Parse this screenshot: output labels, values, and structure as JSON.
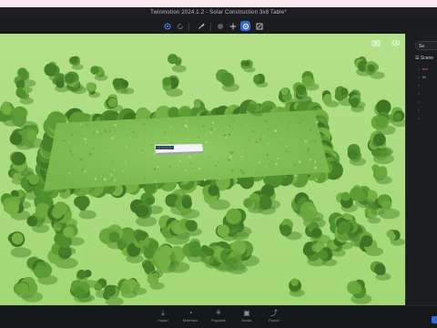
{
  "window": {
    "title": "Twinmotion 2024.1.2 - Solar Construction 3x8 Table*"
  },
  "toolbar": {
    "icons": [
      "snap-icon",
      "refresh-icon",
      "eyedropper-icon",
      "record-icon",
      "move-icon",
      "rotate-icon",
      "scale-icon"
    ],
    "active": "rotate-icon",
    "accent_color": "#2f6bd8"
  },
  "viewport": {
    "scene": "aerial view of cleared grass field surrounded by trees with a solar panel table in the center",
    "icons": [
      "camera-icon",
      "view-options-icon"
    ]
  },
  "side_panel": {
    "search_placeholder": "Se",
    "scene_label": "Scene",
    "tree_items": [
      {
        "label": "Ani",
        "color": "#d66b8a"
      },
      {
        "label": "Br",
        "color": "#aab0ba"
      },
      {
        "label": "",
        "color": "#aab0ba"
      },
      {
        "label": "",
        "color": "#aab0ba"
      },
      {
        "label": "",
        "color": "#aab0ba"
      },
      {
        "label": "",
        "color": "#aab0ba"
      },
      {
        "label": "",
        "color": "#aab0ba"
      }
    ]
  },
  "bottom_bar": {
    "buttons": [
      {
        "label": "Import",
        "icon": "import-icon"
      },
      {
        "label": "Materials",
        "icon": "materials-icon"
      },
      {
        "label": "Populate",
        "icon": "populate-icon"
      },
      {
        "label": "Media",
        "icon": "media-icon"
      },
      {
        "label": "Export",
        "icon": "export-icon"
      }
    ]
  }
}
